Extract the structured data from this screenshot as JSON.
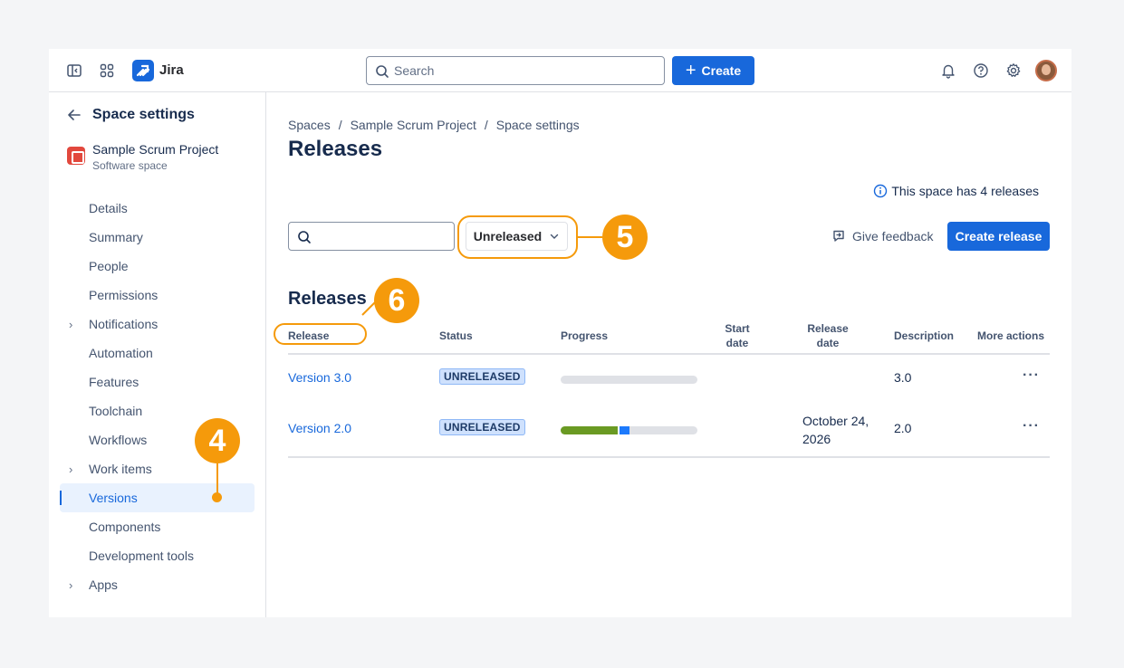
{
  "topbar": {
    "app_name": "Jira",
    "search_placeholder": "Search",
    "create_label": "Create"
  },
  "sidebar": {
    "title": "Space settings",
    "project_name": "Sample Scrum Project",
    "project_type": "Software space",
    "items": [
      {
        "label": "Details",
        "expandable": false
      },
      {
        "label": "Summary",
        "expandable": false
      },
      {
        "label": "People",
        "expandable": false
      },
      {
        "label": "Permissions",
        "expandable": false
      },
      {
        "label": "Notifications",
        "expandable": true
      },
      {
        "label": "Automation",
        "expandable": false
      },
      {
        "label": "Features",
        "expandable": false
      },
      {
        "label": "Toolchain",
        "expandable": false
      },
      {
        "label": "Workflows",
        "expandable": false
      },
      {
        "label": "Work items",
        "expandable": true
      },
      {
        "label": "Versions",
        "expandable": false,
        "active": true
      },
      {
        "label": "Components",
        "expandable": false
      },
      {
        "label": "Development tools",
        "expandable": false
      },
      {
        "label": "Apps",
        "expandable": true
      }
    ]
  },
  "main": {
    "breadcrumbs": [
      "Spaces",
      "Sample Scrum Project",
      "Space settings"
    ],
    "title": "Releases",
    "info_text": "This space has 4 releases",
    "status_filter": "Unreleased",
    "feedback_label": "Give feedback",
    "create_release_label": "Create release",
    "section_title": "Releases"
  },
  "table": {
    "headers": {
      "release": "Release",
      "status": "Status",
      "progress": "Progress",
      "start_date": "Start date",
      "release_date": "Release date",
      "description": "Description",
      "more_actions": "More actions"
    },
    "rows": [
      {
        "name": "Version 3.0",
        "status": "UNRELEASED",
        "progress_done": 0,
        "progress_in_progress": 0,
        "start_date": "",
        "release_date": "",
        "description": "3.0",
        "actions": "···"
      },
      {
        "name": "Version 2.0",
        "status": "UNRELEASED",
        "progress_done": 0.42,
        "progress_in_progress": 0.07,
        "start_date": "",
        "release_date": "October 24, 2026",
        "description": "2.0",
        "actions": "···"
      }
    ]
  },
  "callouts": {
    "four": "4",
    "five": "5",
    "six": "6"
  },
  "colors": {
    "accent": "#1868db",
    "callout": "#f59a0b",
    "done": "#6a9a23",
    "in_progress": "#1d7afc"
  }
}
